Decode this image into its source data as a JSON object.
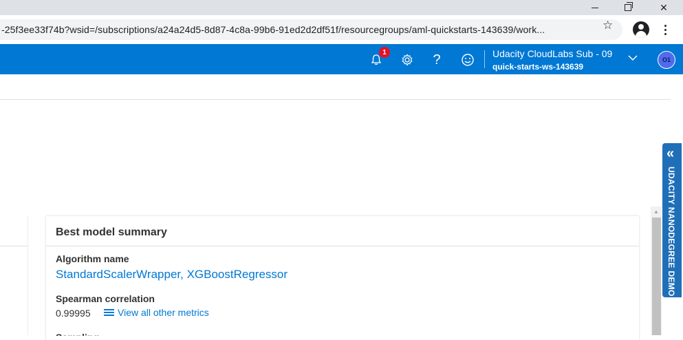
{
  "browser": {
    "url": "-25f3ee33f74b?wsid=/subscriptions/a24a24d5-8d87-4c8a-99b6-91ed2d2df51f/resourcegroups/aml-quickstarts-143639/work..."
  },
  "appbar": {
    "notification_count": "1",
    "help_label": "?",
    "subscription": "Udacity CloudLabs Sub - 09",
    "workspace": "quick-starts-ws-143639",
    "avatar_initials": "O1",
    "colors": {
      "bar": "#0078d4",
      "badge": "#e81123",
      "avatar": "#4f6bed"
    }
  },
  "summary": {
    "title": "Best model summary",
    "algorithm_label": "Algorithm name",
    "algorithm_value": "StandardScalerWrapper, XGBoostRegressor",
    "metric_label": "Spearman correlation",
    "metric_value": "0.99995",
    "metrics_link": "View all other metrics",
    "next_label_partial": "Sampling"
  },
  "side_tab": {
    "label": "UDACITY NANODEGREE DEMO",
    "arrow": "«"
  }
}
